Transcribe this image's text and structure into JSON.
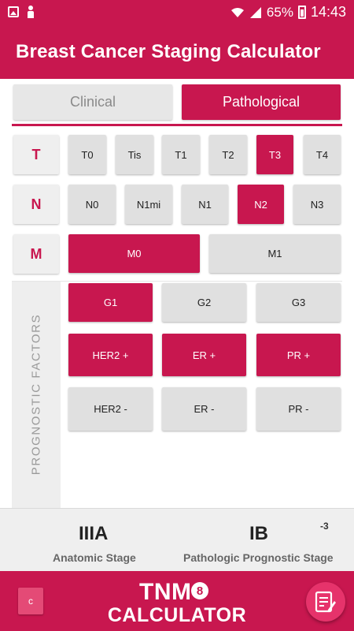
{
  "status_bar": {
    "battery": "65%",
    "time": "14:43"
  },
  "app_bar": {
    "title": "Breast Cancer Staging Calculator"
  },
  "tabs": [
    {
      "label": "Clinical",
      "selected": false
    },
    {
      "label": "Pathological",
      "selected": true
    }
  ],
  "rows": {
    "t": {
      "label": "T",
      "options": [
        {
          "label": "T0",
          "selected": false
        },
        {
          "label": "Tis",
          "selected": false
        },
        {
          "label": "T1",
          "selected": false
        },
        {
          "label": "T2",
          "selected": false
        },
        {
          "label": "T3",
          "selected": true
        },
        {
          "label": "T4",
          "selected": false
        }
      ]
    },
    "n": {
      "label": "N",
      "options": [
        {
          "label": "N0",
          "selected": false
        },
        {
          "label": "N1mi",
          "selected": false
        },
        {
          "label": "N1",
          "selected": false
        },
        {
          "label": "N2",
          "selected": true
        },
        {
          "label": "N3",
          "selected": false
        }
      ]
    },
    "m": {
      "label": "M",
      "options": [
        {
          "label": "M0",
          "selected": true
        },
        {
          "label": "M1",
          "selected": false
        }
      ]
    }
  },
  "prognostic": {
    "label": "PROGNOSTIC FACTORS",
    "grade": [
      {
        "label": "G1",
        "selected": true
      },
      {
        "label": "G2",
        "selected": false
      },
      {
        "label": "G3",
        "selected": false
      }
    ],
    "positive": [
      {
        "label": "HER2 +",
        "selected": true
      },
      {
        "label": "ER +",
        "selected": true
      },
      {
        "label": "PR +",
        "selected": true
      }
    ],
    "negative": [
      {
        "label": "HER2 -",
        "selected": false
      },
      {
        "label": "ER -",
        "selected": false
      },
      {
        "label": "PR -",
        "selected": false
      }
    ]
  },
  "results": {
    "anatomic_stage": "IIIA",
    "anatomic_label": "Anatomic Stage",
    "prognostic_stage": "IB",
    "prognostic_superscript": "-3",
    "prognostic_label": "Pathologic Prognostic Stage"
  },
  "bottom": {
    "c_button": "c",
    "logo_tnm": "TNM",
    "logo_edition": "8",
    "logo_calculator": "CALCULATOR"
  },
  "colors": {
    "accent": "#c8174f",
    "inactive": "#e0e0e0"
  }
}
